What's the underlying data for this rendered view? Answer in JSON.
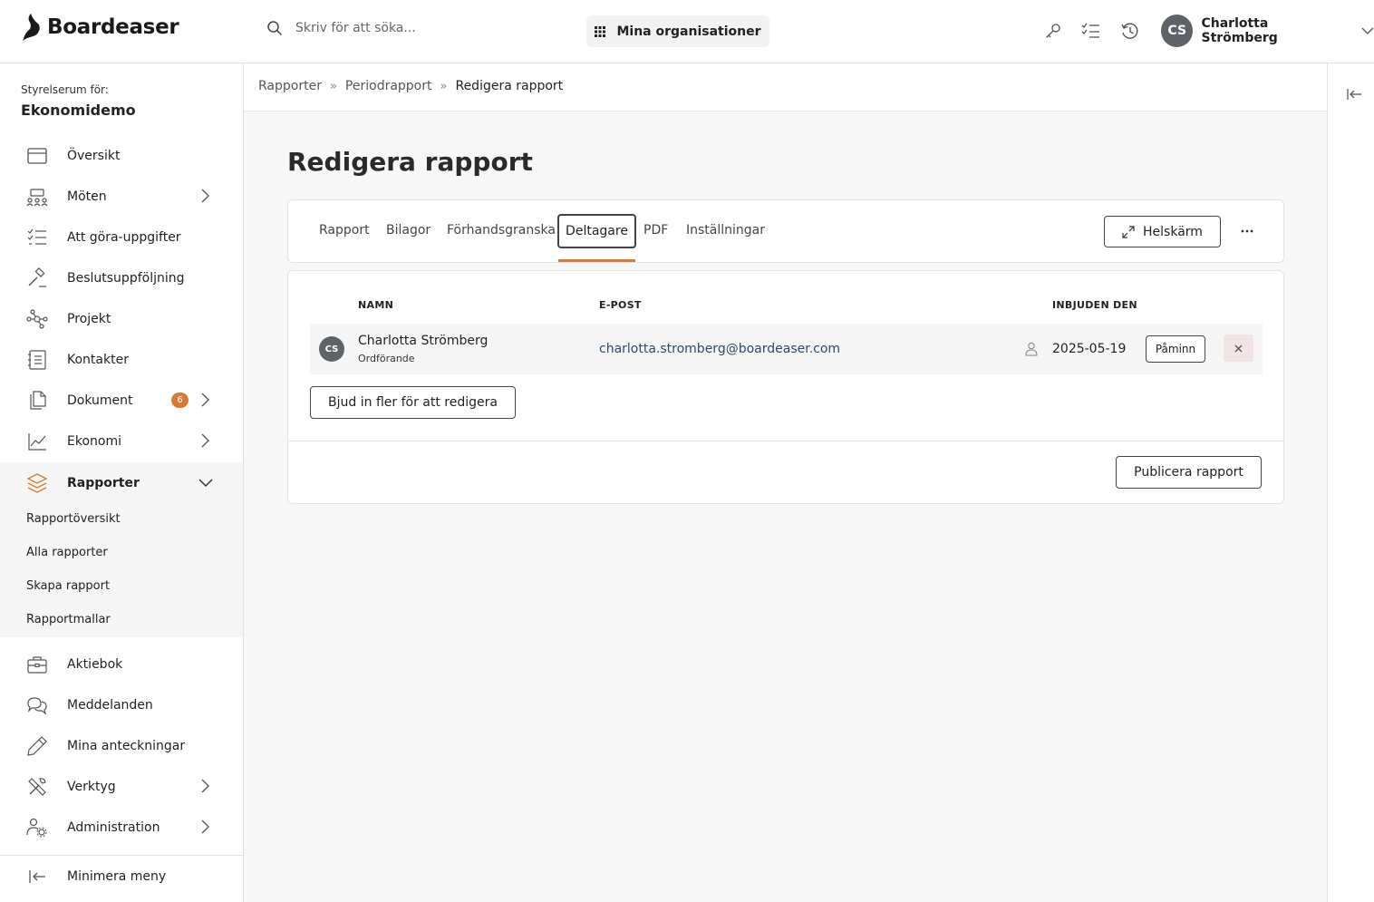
{
  "app": {
    "brand": "Boardeaser",
    "search_placeholder": "Skriv för att söka...",
    "org_button": "Mina organisationer",
    "user": {
      "initials": "CS",
      "name": "Charlotta Strömberg"
    }
  },
  "sidebar": {
    "board_label": "Styrelserum för:",
    "board_name": "Ekonomidemo",
    "items": [
      {
        "label": "Översikt",
        "icon": "calendar-icon"
      },
      {
        "label": "Möten",
        "icon": "meeting-icon"
      },
      {
        "label": "Att göra-uppgifter",
        "icon": "checklist-icon"
      },
      {
        "label": "Beslutsuppföljning",
        "icon": "gavel-icon"
      },
      {
        "label": "Projekt",
        "icon": "network-icon"
      },
      {
        "label": "Kontakter",
        "icon": "contacts-icon"
      },
      {
        "label": "Dokument",
        "icon": "documents-icon",
        "badge": "6"
      },
      {
        "label": "Ekonomi",
        "icon": "chart-line-icon"
      },
      {
        "label": "Rapporter",
        "icon": "layers-icon"
      },
      {
        "label": "Aktiebok",
        "icon": "briefcase-icon"
      },
      {
        "label": "Meddelanden",
        "icon": "chat-icon"
      },
      {
        "label": "Mina anteckningar",
        "icon": "pencil-icon"
      },
      {
        "label": "Verktyg",
        "icon": "tools-icon"
      },
      {
        "label": "Administration",
        "icon": "users-gear-icon"
      }
    ],
    "sub_items": [
      "Rapportöversikt",
      "Alla rapporter",
      "Skapa rapport",
      "Rapportmallar"
    ],
    "minimize_label": "Minimera meny",
    "accent_color": "#d97a34"
  },
  "breadcrumb": [
    "Rapporter",
    "Periodrapport",
    "Redigera rapport"
  ],
  "page": {
    "title": "Redigera rapport",
    "tabs": [
      "Rapport",
      "Bilagor",
      "Förhandsgranska",
      "Deltagare",
      "PDF",
      "Inställningar"
    ],
    "active_tab": "Deltagare",
    "fullscreen_label": "Helskärm"
  },
  "participants": {
    "headers": {
      "name": "NAMN",
      "email": "E-POST",
      "invited": "INBJUDEN DEN"
    },
    "rows": [
      {
        "initials": "CS",
        "name": "Charlotta Strömberg",
        "role": "Ordförande",
        "email": "charlotta.stromberg@boardeaser.com",
        "invited": "2025-05-19",
        "remind_label": "Påminn"
      }
    ],
    "invite_label": "Bjud in fler för att redigera",
    "publish_label": "Publicera rapport"
  }
}
